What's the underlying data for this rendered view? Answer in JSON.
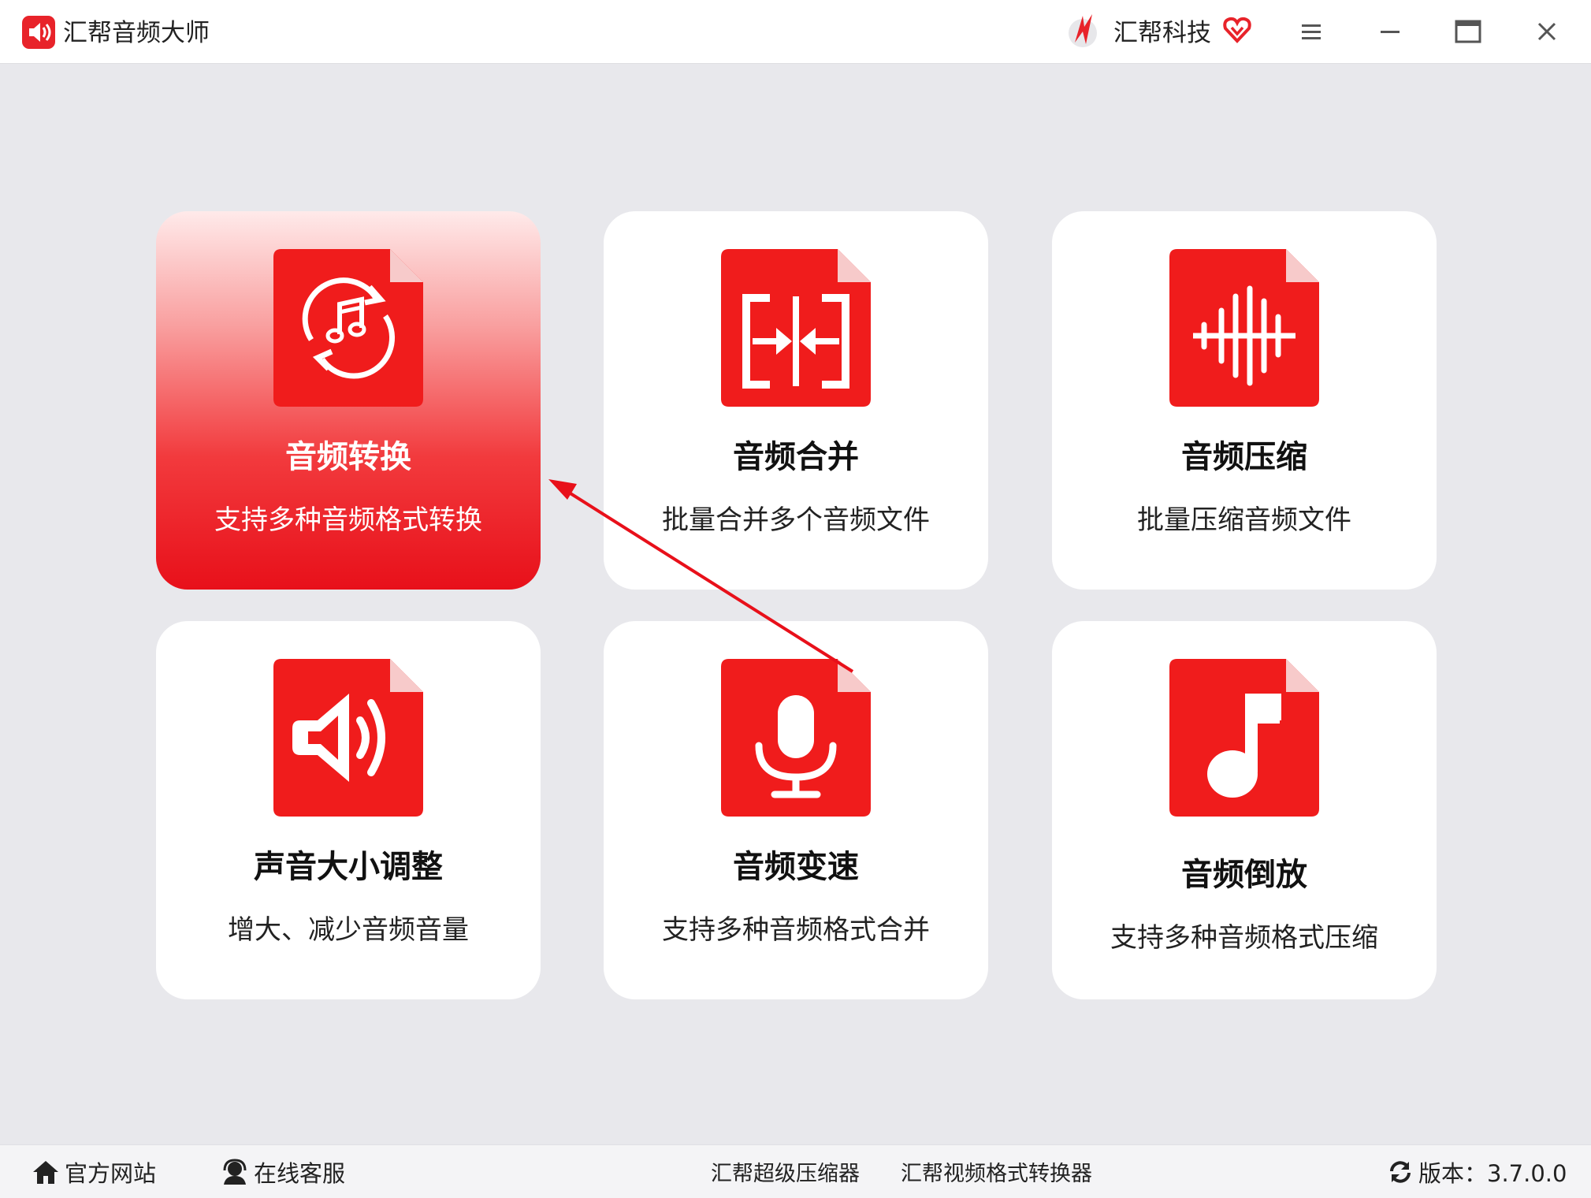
{
  "titlebar": {
    "app_title": "汇帮音频大师",
    "brand_name": "汇帮科技",
    "icons": [
      "speaker-icon",
      "brand-logo",
      "vip-heart-icon",
      "menu-icon",
      "minimize-icon",
      "maximize-icon",
      "close-icon"
    ]
  },
  "cards": [
    {
      "title": "音频转换",
      "desc": "支持多种音频格式转换",
      "icon": "audio-convert-icon",
      "active": true
    },
    {
      "title": "音频合并",
      "desc": "批量合并多个音频文件",
      "icon": "audio-merge-icon"
    },
    {
      "title": "音频压缩",
      "desc": "批量压缩音频文件",
      "icon": "audio-compress-icon"
    },
    {
      "title": "声音大小调整",
      "desc": "增大、减少音频音量",
      "icon": "volume-icon"
    },
    {
      "title": "音频变速",
      "desc": "支持多种音频格式合并",
      "icon": "microphone-icon"
    },
    {
      "title": "音频倒放",
      "desc": "支持多种音频格式压缩",
      "icon": "music-note-icon"
    }
  ],
  "bottombar": {
    "website": "官方网站",
    "support": "在线客服",
    "compressor": "汇帮超级压缩器",
    "video_converter": "汇帮视频格式转换器",
    "version": "版本：3.7.0.0"
  },
  "colors": {
    "accent": "#e8101a",
    "icon_red": "#f01c1c",
    "background": "#e8e8ec"
  }
}
